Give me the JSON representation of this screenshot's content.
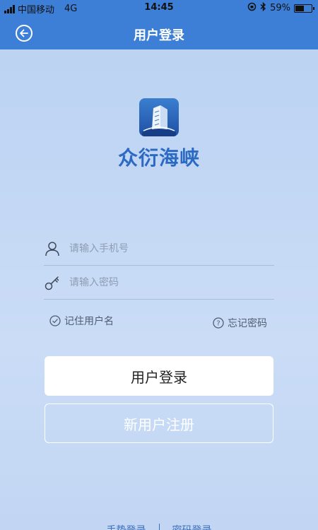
{
  "status_bar": {
    "carrier": "中国移动",
    "network": "4G",
    "time": "14:45",
    "battery_percent": "59%",
    "battery_level": 0.59
  },
  "nav": {
    "title": "用户登录"
  },
  "brand": {
    "name": "众衍海峡",
    "color": "#2b6ac4"
  },
  "form": {
    "phone_placeholder": "请输入手机号",
    "password_placeholder": "请输入密码",
    "remember_label": "记住用户名",
    "forgot_label": "忘记密码"
  },
  "buttons": {
    "login_label": "用户登录",
    "register_label": "新用户注册"
  },
  "bottom": {
    "left_link": "手势登录",
    "right_link": "密码登录"
  },
  "colors": {
    "header": "#3d7fd6",
    "background": "#c4d8f5"
  }
}
